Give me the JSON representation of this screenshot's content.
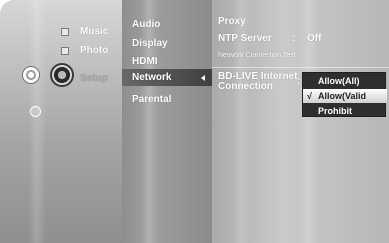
{
  "menu": {
    "col1_items": [
      {
        "label": "Music"
      },
      {
        "label": "Photo"
      },
      {
        "label": "Setup"
      }
    ],
    "col2_items": [
      {
        "label": "Audio"
      },
      {
        "label": "Display"
      },
      {
        "label": "HDMI"
      },
      {
        "label": "Network"
      },
      {
        "label": "Parental"
      }
    ],
    "col3": {
      "proxy_label": "Proxy",
      "ntp_label": "NTP Server",
      "ntp_sep": ":",
      "ntp_value": "Off",
      "nct_label": "Network Connection Test",
      "bdlive_line1": "BD-LIVE Internet",
      "bdlive_line2": "Connection",
      "bdlive_sep": ":"
    },
    "popup": {
      "options": [
        {
          "label": "Allow(All)",
          "checked": false
        },
        {
          "label": "Allow(Valid Only)",
          "checked": true
        },
        {
          "label": "Prohibit",
          "checked": false
        }
      ],
      "check_glyph": "√"
    }
  }
}
